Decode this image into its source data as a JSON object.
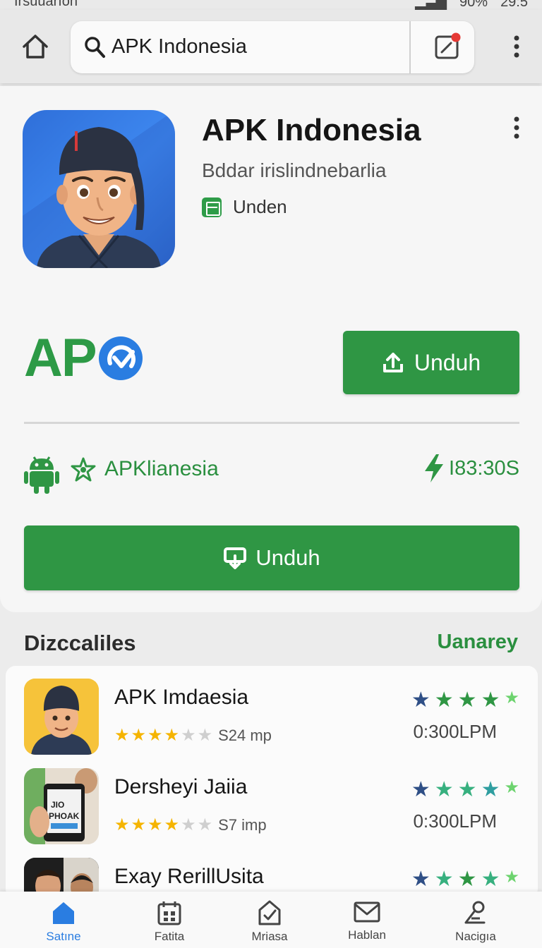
{
  "status_bar": {
    "left_text": "Irsuuarıon",
    "battery": "90%",
    "time": "29:5"
  },
  "browser": {
    "url": "APK Indonesia"
  },
  "app": {
    "title": "APK Indonesia",
    "subtitle": "Bddar irislindnebarlia",
    "tag": "Unden",
    "brand_logo_text": "AP",
    "download_label": "Unduh",
    "meta_name": "APKlianesia",
    "meta_time": "I83:30S",
    "download_big_label": "Unduh"
  },
  "section": {
    "title": "Dizccaliles",
    "link": "Uanarey"
  },
  "list": [
    {
      "title": "APK Imdaesia",
      "rating_stars": 4,
      "rating_meta": "S24 mp",
      "time": "0:300LPM"
    },
    {
      "title": "Dersheyi Jaiia",
      "rating_stars": 4,
      "rating_meta": "S7 imp",
      "time": "0:300LPM"
    },
    {
      "title": "Exay RerillUsita",
      "rating_stars": 4,
      "rating_meta": "",
      "time": ""
    }
  ],
  "thumb_text": {
    "line1": "JIO",
    "line2": "PHOAK"
  },
  "nav": [
    {
      "label": "Satıne",
      "icon": "home-icon",
      "active": true
    },
    {
      "label": "Fatita",
      "icon": "calendar-icon"
    },
    {
      "label": "Mriasa",
      "icon": "edit-icon"
    },
    {
      "label": "Hablan",
      "icon": "mail-icon"
    },
    {
      "label": "Nacigıa",
      "icon": "pen-icon"
    }
  ],
  "colors": {
    "accent_green": "#2f9644",
    "text_green": "#2a8f3f",
    "nav_active": "#2a7de1",
    "star_yellow": "#f5b400"
  }
}
